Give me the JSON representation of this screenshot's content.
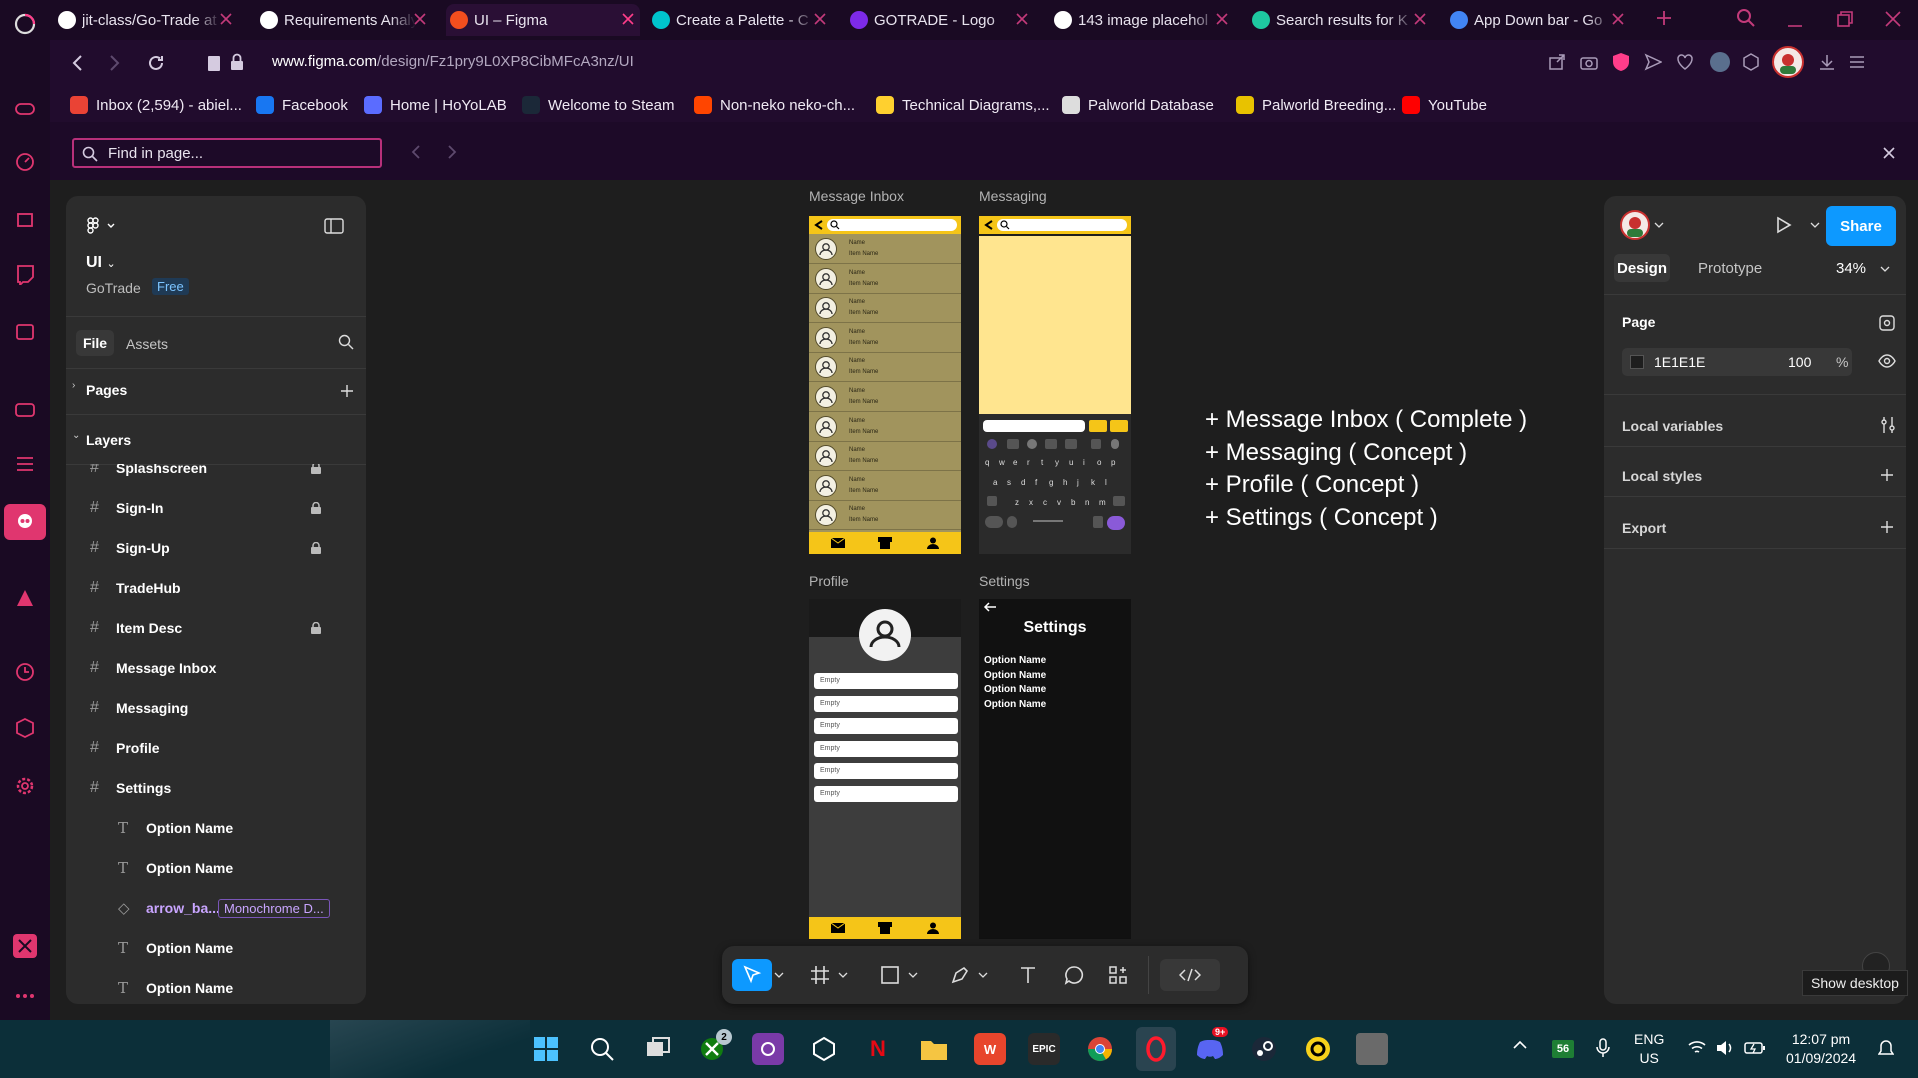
{
  "browser": {
    "tabs": [
      {
        "title": "jit-class/Go-Trade at",
        "icon": "github-icon",
        "color": "#ffffff"
      },
      {
        "title": "Requirements Analy",
        "icon": "openai-icon",
        "color": "#ffffff"
      },
      {
        "title": "UI – Figma",
        "icon": "figma-icon",
        "color": "#f24e1e",
        "active": true
      },
      {
        "title": "Create a Palette - C",
        "icon": "canva-icon",
        "color": "#00c4cc"
      },
      {
        "title": "GOTRADE - Logo",
        "icon": "canva-icon",
        "color": "#7d2ae8"
      },
      {
        "title": "143 image placehol",
        "icon": "flame-icon",
        "color": "#ffffff"
      },
      {
        "title": "Search results for K",
        "icon": "vectorizer-icon",
        "color": "#1ec8a0"
      },
      {
        "title": "App Down bar - Go",
        "icon": "google-icon",
        "color": "#4285f4"
      }
    ],
    "url_host": "www.figma.com",
    "url_path": "/design/Fz1pry9L0XP8CibMFcA3nz/UI",
    "bookmarks": [
      {
        "label": "Inbox (2,594) - abiel...",
        "icon": "gmail-icon",
        "color": "#ea4335"
      },
      {
        "label": "Facebook",
        "icon": "facebook-icon",
        "color": "#1877f2"
      },
      {
        "label": "Home | HoYoLAB",
        "icon": "hoyolab-icon",
        "color": "#5b6cff"
      },
      {
        "label": "Welcome to Steam",
        "icon": "steam-icon",
        "color": "#1b2838"
      },
      {
        "label": "Non-neko neko-ch...",
        "icon": "reddit-icon",
        "color": "#ff4500"
      },
      {
        "label": "Technical Diagrams,...",
        "icon": "miro-icon",
        "color": "#ffd02f"
      },
      {
        "label": "Palworld Database",
        "icon": "palworld-icon",
        "color": "#dddddd"
      },
      {
        "label": "Palworld Breeding...",
        "icon": "breeding-icon",
        "color": "#e8c200"
      },
      {
        "label": "YouTube",
        "icon": "youtube-icon",
        "color": "#ff0000"
      }
    ],
    "find_placeholder": "Find in page..."
  },
  "figma": {
    "file_name": "UI",
    "project": "GoTrade",
    "plan_badge": "Free",
    "tabs": {
      "file": "File",
      "assets": "Assets"
    },
    "pages_label": "Pages",
    "layers_label": "Layers",
    "layers": [
      {
        "name": "Splashscreen",
        "type": "frame",
        "locked": true
      },
      {
        "name": "Sign-In",
        "type": "frame",
        "locked": true
      },
      {
        "name": "Sign-Up",
        "type": "frame",
        "locked": true
      },
      {
        "name": "TradeHub",
        "type": "frame",
        "locked": false
      },
      {
        "name": "Item Desc",
        "type": "frame",
        "locked": true
      },
      {
        "name": "Message Inbox",
        "type": "frame",
        "locked": false
      },
      {
        "name": "Messaging",
        "type": "frame",
        "locked": false
      },
      {
        "name": "Profile",
        "type": "frame",
        "locked": false
      },
      {
        "name": "Settings",
        "type": "frame",
        "locked": false
      },
      {
        "name": "Option Name",
        "type": "text"
      },
      {
        "name": "Option Name",
        "type": "text"
      },
      {
        "name": "arrow_ba...",
        "type": "instance",
        "tag": "Monochrome D..."
      },
      {
        "name": "Option Name",
        "type": "text"
      },
      {
        "name": "Option Name",
        "type": "text"
      }
    ],
    "right": {
      "share": "Share",
      "design_tab": "Design",
      "prototype_tab": "Prototype",
      "zoom": "34%",
      "page_label": "Page",
      "page_color": "1E1E1E",
      "page_opacity": "100",
      "percent": "%",
      "local_variables": "Local variables",
      "local_styles": "Local styles",
      "export": "Export"
    },
    "frames": {
      "inbox_label": "Message Inbox",
      "messaging_label": "Messaging",
      "profile_label": "Profile",
      "settings_label": "Settings",
      "inbox_rows": [
        {
          "name": "Name",
          "item": "Item Name"
        },
        {
          "name": "Name",
          "item": "Item Name"
        },
        {
          "name": "Name",
          "item": "Item Name"
        },
        {
          "name": "Name",
          "item": "Item Name"
        },
        {
          "name": "Name",
          "item": "Item Name"
        },
        {
          "name": "Name",
          "item": "Item Name"
        },
        {
          "name": "Name",
          "item": "Item Name"
        },
        {
          "name": "Name",
          "item": "Item Name"
        },
        {
          "name": "Name",
          "item": "Item Name"
        },
        {
          "name": "Name",
          "item": "Item Name"
        }
      ],
      "profile_fields": [
        "Empty",
        "Empty",
        "Empty",
        "Empty",
        "Empty",
        "Empty"
      ],
      "settings_title": "Settings",
      "settings_options": [
        "Option Name",
        "Option Name",
        "Option Name",
        "Option Name"
      ],
      "keyboard_rows": [
        "qwertyuiop",
        "asdfghjkl",
        "zxcvbnm"
      ]
    },
    "notes": [
      "+ Message Inbox ( Complete )",
      "+ Messaging ( Concept )",
      "+ Profile ( Concept )",
      "+ Settings ( Concept )"
    ],
    "tooltip": "Show desktop"
  },
  "taskbar": {
    "lang_top": "ENG",
    "lang_bottom": "US",
    "time": "12:07 pm",
    "date": "01/09/2024",
    "xbox_badge": "2",
    "discord_badge": "9+",
    "battery_level": "56"
  },
  "colors": {
    "accent": "#0d99ff",
    "opera_red": "#ff1b2d",
    "frame_yellow": "#f5c518",
    "inbox_olive": "#a1945d"
  }
}
